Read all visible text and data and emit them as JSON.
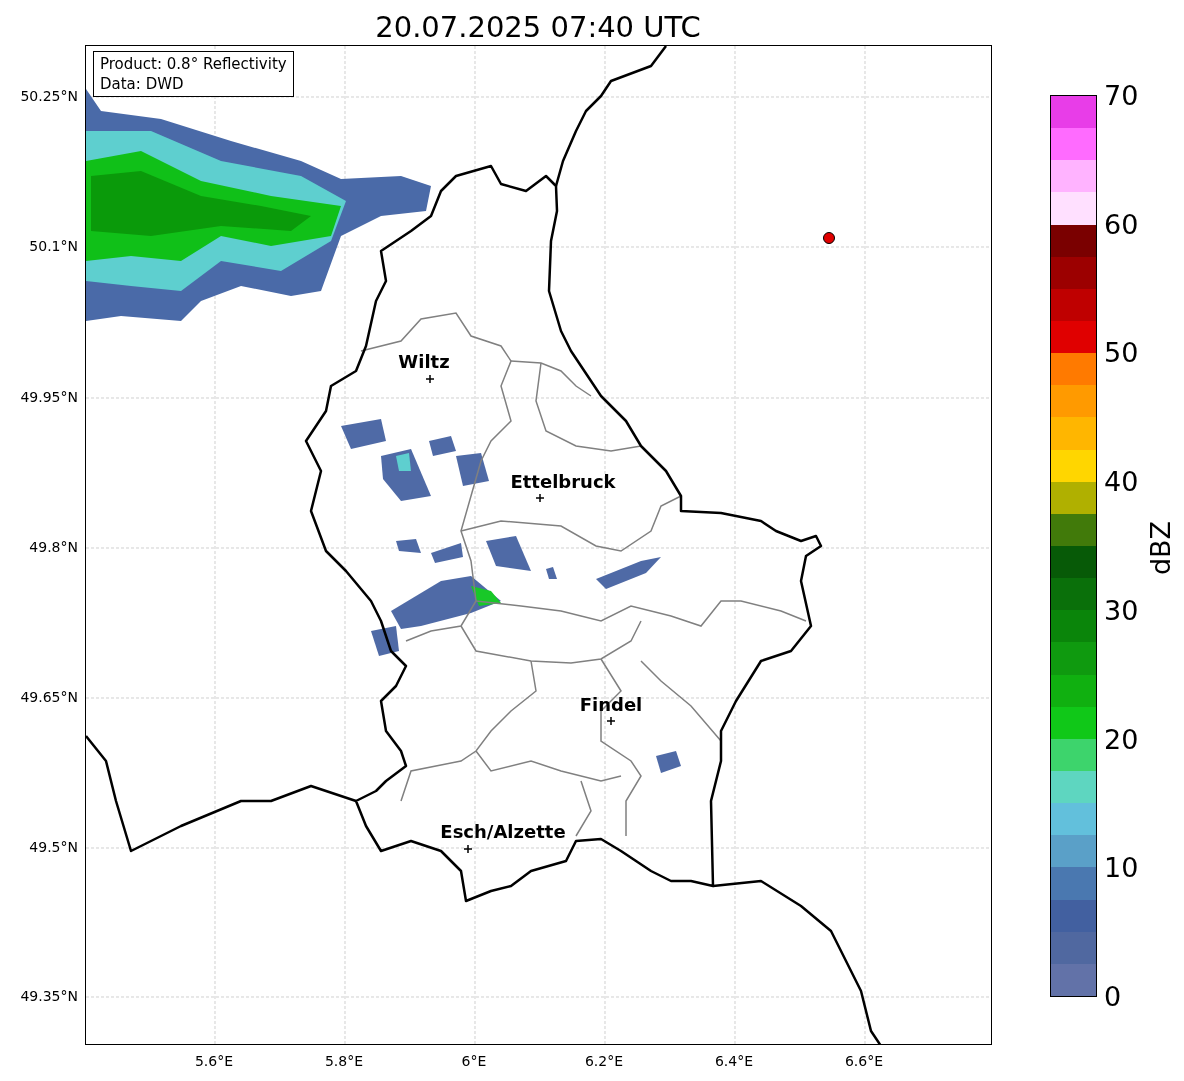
{
  "title": "20.07.2025 07:40 UTC",
  "info_box": [
    "Product: 0.8° Reflectivity",
    "Data: DWD"
  ],
  "y_ticks": [
    "50.25°N",
    "50.1°N",
    "49.95°N",
    "49.8°N",
    "49.65°N",
    "49.5°N",
    "49.35°N"
  ],
  "x_ticks": [
    "5.6°E",
    "5.8°E",
    "6°E",
    "6.2°E",
    "6.4°E",
    "6.6°E"
  ],
  "cities": [
    {
      "name": "Wiltz"
    },
    {
      "name": "Ettelbruck"
    },
    {
      "name": "Findel"
    },
    {
      "name": "Esch/Alzette"
    }
  ],
  "colorbar": {
    "label": "dBZ",
    "ticks": [
      "70",
      "60",
      "50",
      "40",
      "30",
      "20",
      "10",
      "0"
    ],
    "bins": [
      {
        "color": "#e83de8"
      },
      {
        "color": "#ff6bff"
      },
      {
        "color": "#ffb3ff"
      },
      {
        "color": "#ffe0ff"
      },
      {
        "color": "#7a0000"
      },
      {
        "color": "#9c0000"
      },
      {
        "color": "#bf0000"
      },
      {
        "color": "#e00000"
      },
      {
        "color": "#ff7a00"
      },
      {
        "color": "#ff9a00"
      },
      {
        "color": "#ffb600"
      },
      {
        "color": "#ffd600"
      },
      {
        "color": "#b0b000"
      },
      {
        "color": "#417a0a"
      },
      {
        "color": "#075a07"
      },
      {
        "color": "#0a700a"
      },
      {
        "color": "#0a850a"
      },
      {
        "color": "#0f9a0f"
      },
      {
        "color": "#10b010"
      },
      {
        "color": "#10c818"
      },
      {
        "color": "#3dd46c"
      },
      {
        "color": "#5ed6c0"
      },
      {
        "color": "#62c0dc"
      },
      {
        "color": "#5aa0c8"
      },
      {
        "color": "#4a78b0"
      },
      {
        "color": "#4260a0"
      },
      {
        "color": "#5068a0"
      },
      {
        "color": "#6272a8"
      }
    ]
  }
}
